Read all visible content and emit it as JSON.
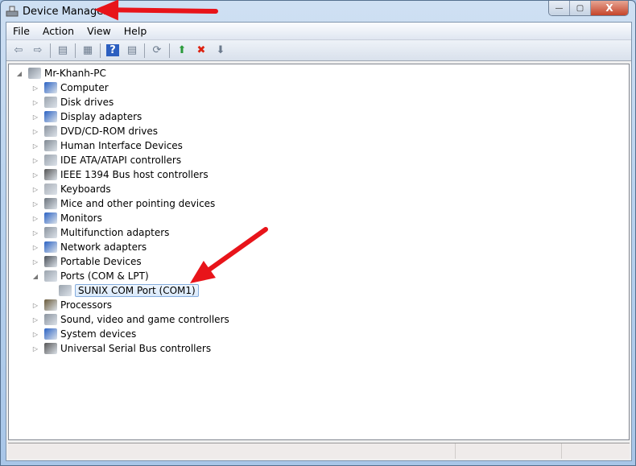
{
  "window": {
    "title": "Device Manager",
    "minimize": "—",
    "maximize": "▢",
    "close": "X"
  },
  "menu": [
    "File",
    "Action",
    "View",
    "Help"
  ],
  "toolbar": [
    {
      "icon": "back-arrow-icon",
      "glyph": "⇦"
    },
    {
      "icon": "forward-arrow-icon",
      "glyph": "⇨"
    },
    {
      "icon": "show-hide-console-tree-icon",
      "glyph": "▤"
    },
    {
      "icon": "properties-icon",
      "glyph": "▦"
    },
    {
      "icon": "help-icon",
      "glyph": "?"
    },
    {
      "icon": "show-action-pane-icon",
      "glyph": "▤"
    },
    {
      "icon": "scan-hardware-icon",
      "glyph": "⟳"
    },
    {
      "icon": "update-driver-icon",
      "glyph": "⬆"
    },
    {
      "icon": "uninstall-icon",
      "glyph": "✖"
    },
    {
      "icon": "disable-device-icon",
      "glyph": "⬇"
    }
  ],
  "tree": {
    "root": "Mr-Khanh-PC",
    "categories": [
      {
        "label": "Computer",
        "color": "#2a62c4"
      },
      {
        "label": "Disk drives",
        "color": "#9aa3ad"
      },
      {
        "label": "Display adapters",
        "color": "#2a62c4"
      },
      {
        "label": "DVD/CD-ROM drives",
        "color": "#8a939e"
      },
      {
        "label": "Human Interface Devices",
        "color": "#7f8891"
      },
      {
        "label": "IDE ATA/ATAPI controllers",
        "color": "#9aa3ad"
      },
      {
        "label": "IEEE 1394 Bus host controllers",
        "color": "#555"
      },
      {
        "label": "Keyboards",
        "color": "#aab0b8"
      },
      {
        "label": "Mice and other pointing devices",
        "color": "#6b737c"
      },
      {
        "label": "Monitors",
        "color": "#2a62c4"
      },
      {
        "label": "Multifunction adapters",
        "color": "#8a939e"
      },
      {
        "label": "Network adapters",
        "color": "#2a62c4"
      },
      {
        "label": "Portable Devices",
        "color": "#4a5058"
      },
      {
        "label": "Ports (COM & LPT)",
        "color": "#9aa3ad",
        "expanded": true,
        "children": [
          {
            "label": "SUNIX COM Port (COM1)",
            "selected": true
          }
        ]
      },
      {
        "label": "Processors",
        "color": "#6a5a3a"
      },
      {
        "label": "Sound, video and game controllers",
        "color": "#8a939e"
      },
      {
        "label": "System devices",
        "color": "#2a62c4"
      },
      {
        "label": "Universal Serial Bus controllers",
        "color": "#555"
      }
    ]
  },
  "annotation_color": "#e8141a"
}
